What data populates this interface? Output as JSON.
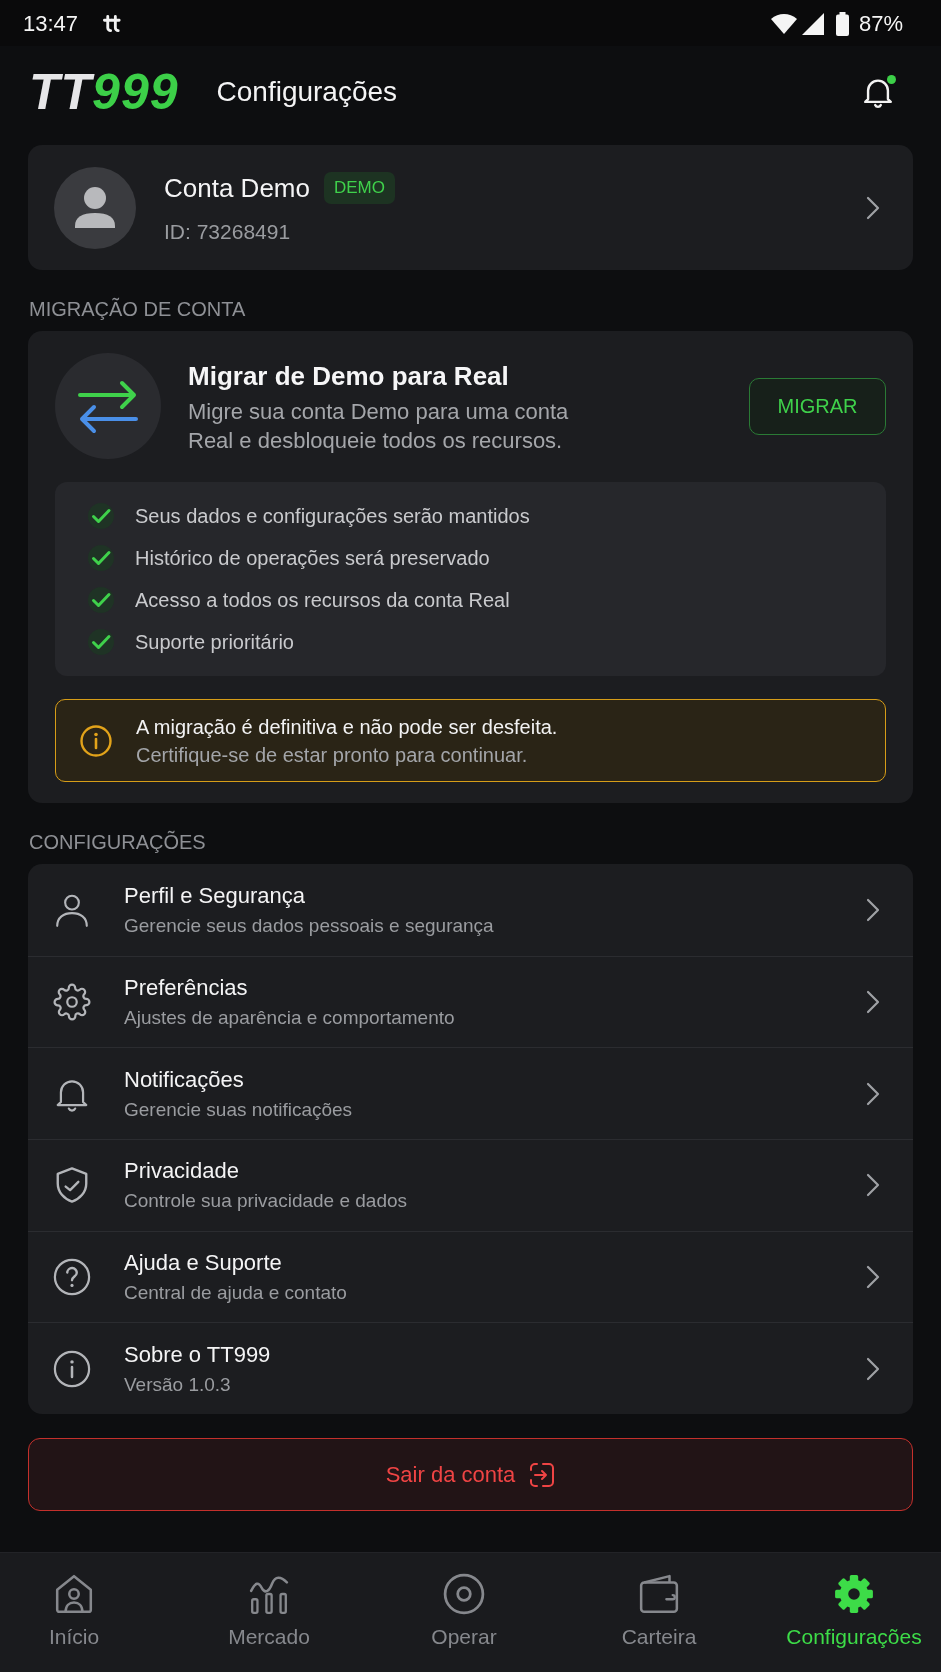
{
  "status_bar": {
    "time": "13:47",
    "battery": "87%"
  },
  "header": {
    "logo": {
      "prefix": "TT",
      "suffix": "999"
    },
    "title": "Configurações",
    "notification_dot": true
  },
  "account": {
    "name": "Conta Demo",
    "badge": "DEMO",
    "id": "ID: 73268491"
  },
  "migration": {
    "section_label": "MIGRAÇÃO DE CONTA",
    "title": "Migrar de Demo para Real",
    "description": "Migre sua conta Demo para uma conta Real e desbloqueie todos os recursos.",
    "button": "MIGRAR",
    "benefits": [
      "Seus dados e configurações serão mantidos",
      "Histórico de operações será preservado",
      "Acesso a todos os recursos da conta Real",
      "Suporte prioritário"
    ],
    "warning": {
      "title": "A migração é definitiva e não pode ser desfeita.",
      "text": "Certifique-se de estar pronto para continuar."
    }
  },
  "settings": {
    "section_label": "CONFIGURAÇÕES",
    "items": [
      {
        "title": "Perfil e Segurança",
        "subtitle": "Gerencie seus dados pessoais e segurança"
      },
      {
        "title": "Preferências",
        "subtitle": "Ajustes de aparência e comportamento"
      },
      {
        "title": "Notificações",
        "subtitle": "Gerencie suas notificações"
      },
      {
        "title": "Privacidade",
        "subtitle": "Controle sua privacidade e dados"
      },
      {
        "title": "Ajuda e Suporte",
        "subtitle": "Central de ajuda e contato"
      },
      {
        "title": "Sobre o TT999",
        "subtitle": "Versão 1.0.3"
      }
    ]
  },
  "logout_button": "Sair da conta",
  "bottom_nav": [
    {
      "label": "Início",
      "selected": false
    },
    {
      "label": "Mercado",
      "selected": false
    },
    {
      "label": "Operar",
      "selected": false
    },
    {
      "label": "Carteira",
      "selected": false
    },
    {
      "label": "Configurações",
      "selected": true
    }
  ]
}
